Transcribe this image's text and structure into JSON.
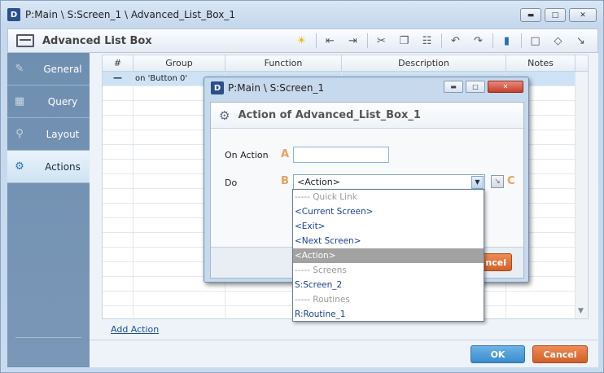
{
  "window": {
    "title": "P:Main \\ S:Screen_1 \\ Advanced_List_Box_1",
    "logo": "D"
  },
  "toolbar": {
    "title": "Advanced List Box",
    "tools": [
      "lightbulb-icon",
      "outdent-icon",
      "indent-icon",
      "cut-icon",
      "copy-icon",
      "paste-icon",
      "undo-icon",
      "redo-icon",
      "comment-icon",
      "speech-icon",
      "tag-icon",
      "jump-icon"
    ]
  },
  "sidebar": {
    "items": [
      {
        "label": "General",
        "icon": "pencil-icon"
      },
      {
        "label": "Query",
        "icon": "table-icon"
      },
      {
        "label": "Layout",
        "icon": "magnify-icon"
      },
      {
        "label": "Actions",
        "icon": "gears-icon",
        "active": true
      }
    ]
  },
  "grid": {
    "columns": [
      "#",
      "Group",
      "Function",
      "Description",
      "Notes"
    ],
    "row": {
      "num": "—",
      "group": "on 'Button 0'"
    }
  },
  "add_action": "Add Action",
  "buttons": {
    "ok": "OK",
    "cancel": "Cancel"
  },
  "dialog": {
    "title": "P:Main \\ S:Screen_1",
    "heading": "Action of Advanced_List_Box_1",
    "on_action_label": "On Action",
    "letter_a": "A",
    "do_label": "Do",
    "letter_b": "B",
    "letter_c": "C",
    "do_value": "<Action>",
    "cancel_partial": "ncel"
  },
  "dropdown": {
    "items": [
      {
        "label": "----- Quick Link",
        "type": "header"
      },
      {
        "label": "<Current Screen>"
      },
      {
        "label": "<Exit>"
      },
      {
        "label": "<Next Screen>"
      },
      {
        "label": "<Action>",
        "selected": true
      },
      {
        "label": "----- Screens",
        "type": "header"
      },
      {
        "label": "S:Screen_2"
      },
      {
        "label": "----- Routines",
        "type": "header"
      },
      {
        "label": "R:Routine_1"
      }
    ]
  },
  "colors": {
    "accent": "#3b8ccc",
    "cancel": "#d2612a",
    "letters": "#e2a35c"
  }
}
